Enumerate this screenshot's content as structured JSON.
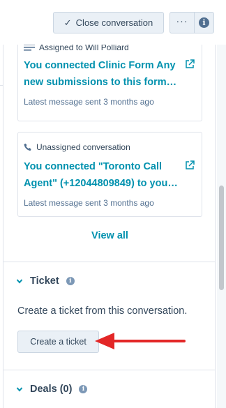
{
  "toolbar": {
    "close_label": "Close conversation",
    "more_label": "···",
    "info_label": "i"
  },
  "conversations": [
    {
      "meta": "Assigned to Will Polliard",
      "meta_icon": "lines-icon",
      "title_line1": "You connected Clinic Form Any",
      "title_line2": "new submissions to this form…",
      "footer": "Latest message sent 3 months ago"
    },
    {
      "meta": "Unassigned conversation",
      "meta_icon": "phone-icon",
      "title_line1": "You connected \"Toronto Call",
      "title_line2": "Agent\" (+12044809849) to you…",
      "footer": "Latest message sent 3 months ago"
    }
  ],
  "view_all_label": "View all",
  "ticket": {
    "title": "Ticket",
    "help": "i",
    "description": "Create a ticket from this conversation.",
    "button_label": "Create a ticket"
  },
  "deals": {
    "title": "Deals (0)",
    "help": "i"
  },
  "colors": {
    "link": "#0091ae",
    "text": "#33475b",
    "button_bg": "#eaf0f6",
    "annotation_arrow": "#e32727"
  }
}
